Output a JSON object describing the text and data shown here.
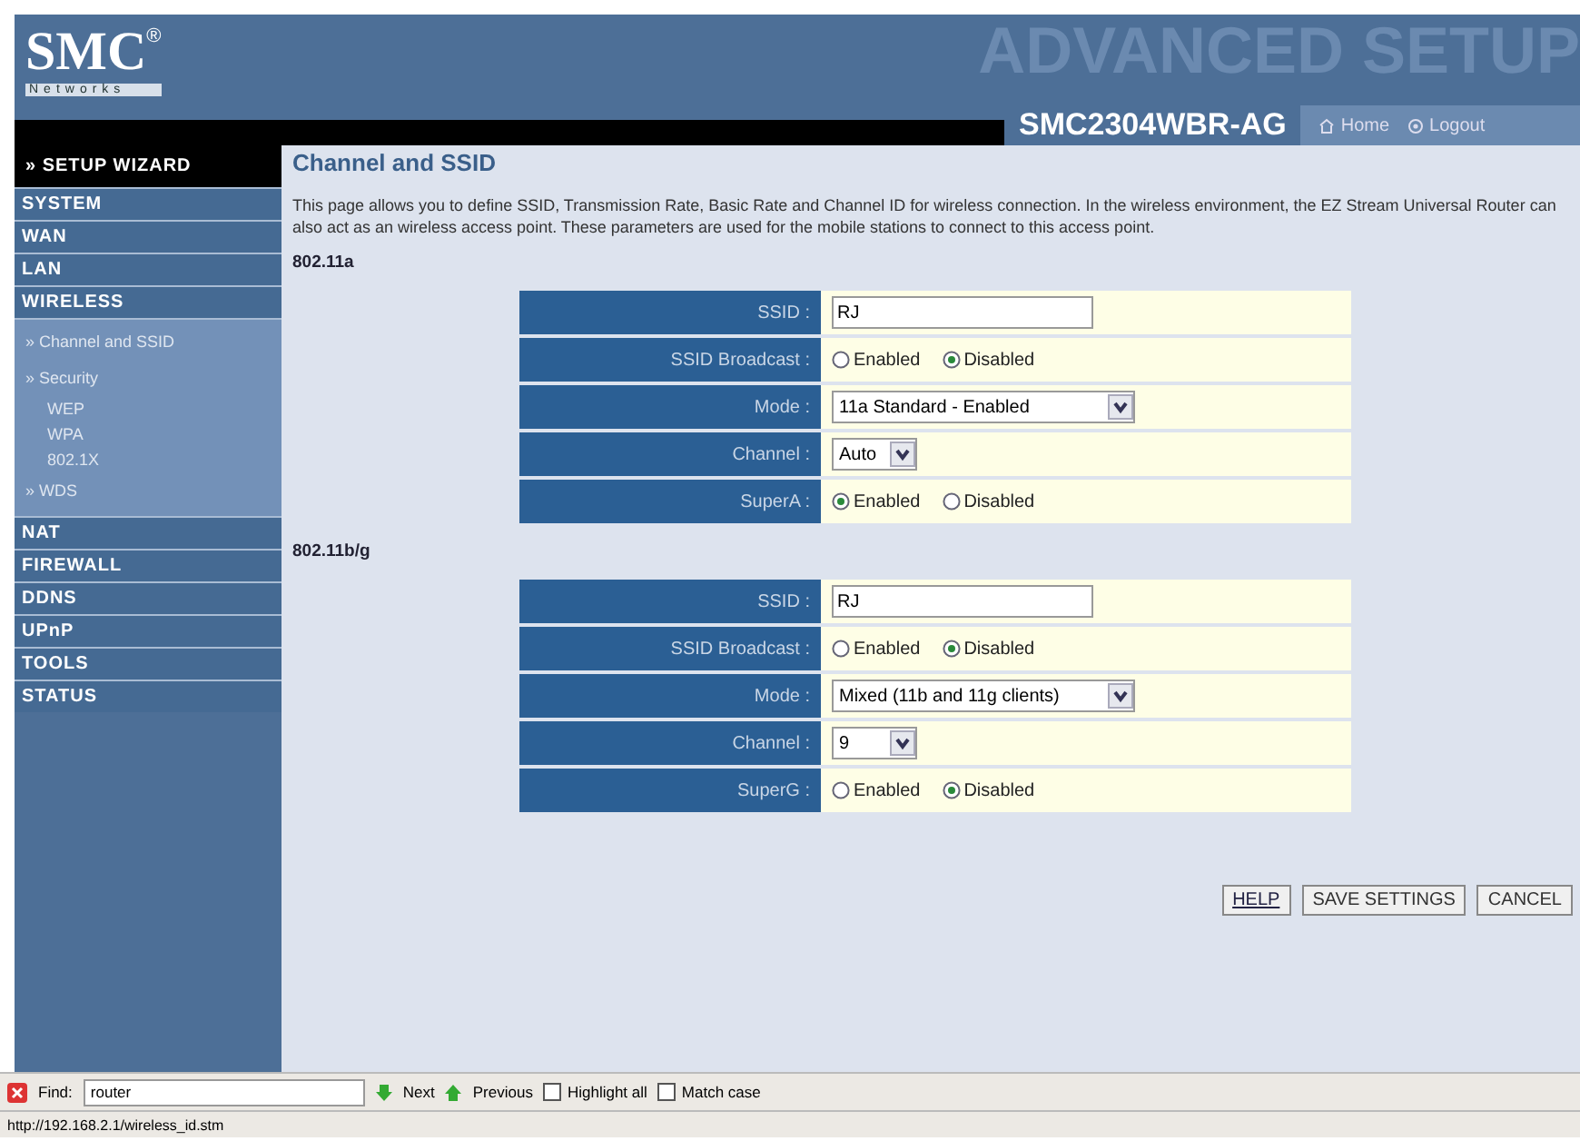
{
  "header": {
    "logo": "SMC",
    "logo_mark": "®",
    "logo_sub": "Networks",
    "banner": "ADVANCED SETUP",
    "model": "SMC2304WBR-AG",
    "links": [
      "Home",
      "Logout"
    ]
  },
  "sidebar": {
    "wizard": "» SETUP WIZARD",
    "items": [
      {
        "label": "SYSTEM"
      },
      {
        "label": "WAN"
      },
      {
        "label": "LAN"
      },
      {
        "label": "WIRELESS",
        "children": [
          {
            "label": "» Channel and SSID"
          },
          {
            "label": "» Security",
            "children": [
              {
                "label": "WEP"
              },
              {
                "label": "WPA"
              },
              {
                "label": "802.1X"
              }
            ]
          },
          {
            "label": "» WDS"
          }
        ]
      },
      {
        "label": "NAT"
      },
      {
        "label": "FIREWALL"
      },
      {
        "label": "DDNS"
      },
      {
        "label": "UPnP"
      },
      {
        "label": "TOOLS"
      },
      {
        "label": "STATUS"
      }
    ]
  },
  "page": {
    "title": "Channel and SSID",
    "description": "This page allows you to define SSID, Transmission Rate, Basic Rate and Channel ID for wireless connection.  In the wireless environment, the EZ Stream Universal Router can also act as an wireless access point.  These parameters are used for the mobile stations to connect to this access point.",
    "sections": [
      {
        "heading": "802.11a",
        "rows": [
          {
            "kind": "text",
            "label": "SSID :",
            "value": "RJ"
          },
          {
            "kind": "radio",
            "label": "SSID Broadcast :",
            "options": [
              {
                "label": "Enabled",
                "selected": false
              },
              {
                "label": "Disabled",
                "selected": true
              }
            ]
          },
          {
            "kind": "select",
            "label": "Mode :",
            "value": "11a Standard - Enabled",
            "wide": true
          },
          {
            "kind": "select",
            "label": "Channel :",
            "value": "Auto",
            "wide": false
          },
          {
            "kind": "radio",
            "label": "SuperA :",
            "options": [
              {
                "label": "Enabled",
                "selected": true
              },
              {
                "label": "Disabled",
                "selected": false
              }
            ]
          }
        ]
      },
      {
        "heading": "802.11b/g",
        "rows": [
          {
            "kind": "text",
            "label": "SSID :",
            "value": "RJ"
          },
          {
            "kind": "radio",
            "label": "SSID Broadcast :",
            "options": [
              {
                "label": "Enabled",
                "selected": false
              },
              {
                "label": "Disabled",
                "selected": true
              }
            ]
          },
          {
            "kind": "select",
            "label": "Mode :",
            "value": "Mixed (11b and 11g clients)",
            "wide": true
          },
          {
            "kind": "select",
            "label": "Channel :",
            "value": "9",
            "wide": false
          },
          {
            "kind": "radio",
            "label": "SuperG :",
            "options": [
              {
                "label": "Enabled",
                "selected": false
              },
              {
                "label": "Disabled",
                "selected": true
              }
            ]
          }
        ]
      }
    ],
    "buttons": [
      "HELP",
      "SAVE SETTINGS",
      "CANCEL"
    ]
  },
  "find_bar": {
    "label": "Find:",
    "value": "router",
    "next": "Next",
    "previous": "Previous",
    "options": [
      {
        "label": "Highlight all",
        "checked": false
      },
      {
        "label": "Match case",
        "checked": false
      }
    ]
  },
  "status_bar": "http://192.168.2.1/wireless_id.stm"
}
